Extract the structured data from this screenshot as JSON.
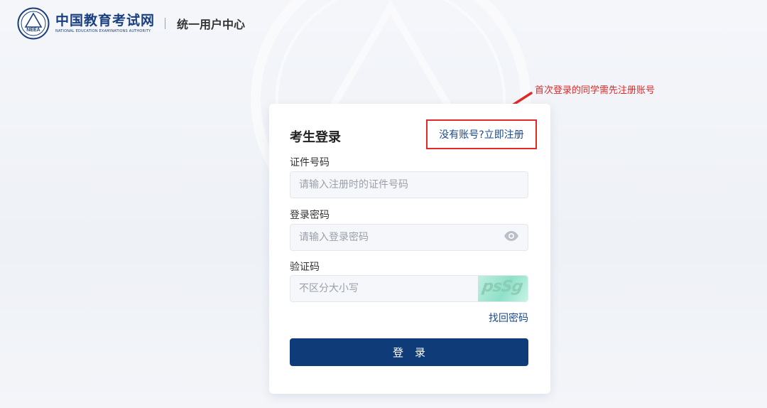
{
  "header": {
    "logo_cn": "中国教育考试网",
    "logo_en": "NATIONAL EDUCATION EXAMINATIONS AUTHORITY",
    "logo_emblem_text": "NEEA",
    "title": "统一用户中心"
  },
  "annotation": {
    "text": "首次登录的同学需先注册账号",
    "color": "#e02a2a"
  },
  "login": {
    "title": "考生登录",
    "register_link": "没有账号?立即注册",
    "id_label": "证件号码",
    "id_placeholder": "请输入注册时的证件号码",
    "password_label": "登录密码",
    "password_placeholder": "请输入登录密码",
    "captcha_label": "验证码",
    "captcha_placeholder": "不区分大小写",
    "captcha_text": "psSg",
    "forgot_password": "找回密码",
    "submit": "登录"
  },
  "icons": {
    "password_toggle": "eye-icon",
    "logo": "neea-emblem-icon"
  },
  "colors": {
    "brand": "#1a3f80",
    "button": "#0f3c79",
    "link": "#1a4a8e",
    "annotation": "#e02a2a"
  }
}
